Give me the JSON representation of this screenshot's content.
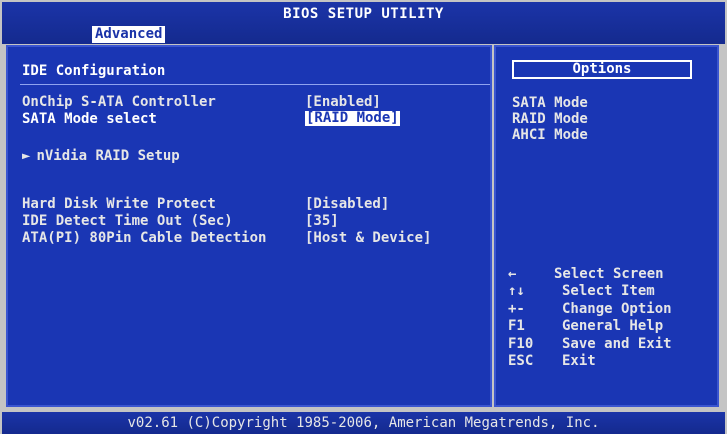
{
  "header": {
    "title": "BIOS SETUP UTILITY",
    "active_tab": "Advanced"
  },
  "main": {
    "section_title": "IDE Configuration",
    "settings": [
      {
        "label": "OnChip S-ATA Controller",
        "value": "[Enabled]",
        "selected": false
      },
      {
        "label": "SATA Mode select",
        "value": "[RAID Mode]",
        "selected": true
      }
    ],
    "submenu": {
      "arrow": "►",
      "label": "nVidia RAID Setup"
    },
    "settings2": [
      {
        "label": "Hard Disk Write Protect",
        "value": "[Disabled]"
      },
      {
        "label": "IDE Detect Time Out (Sec)",
        "value": "[35]"
      },
      {
        "label": "ATA(PI) 80Pin Cable Detection",
        "value": "[Host & Device]"
      }
    ]
  },
  "side": {
    "options_title": "Options",
    "options": [
      "SATA Mode",
      "RAID Mode",
      "AHCI Mode"
    ],
    "help": [
      {
        "key": "←",
        "desc": "Select Screen"
      },
      {
        "key": "↑↓",
        "desc": "Select Item"
      },
      {
        "key": "+-",
        "desc": "Change Option"
      },
      {
        "key": "F1",
        "desc": "General Help"
      },
      {
        "key": "F10",
        "desc": "Save and Exit"
      },
      {
        "key": "ESC",
        "desc": "Exit"
      }
    ]
  },
  "footer": {
    "copyright": "v02.61 (C)Copyright 1985-2006, American Megatrends, Inc."
  },
  "colors": {
    "background_blue": "#1a36b4",
    "text": "#e6e6e6",
    "highlight": "#ffffff"
  }
}
